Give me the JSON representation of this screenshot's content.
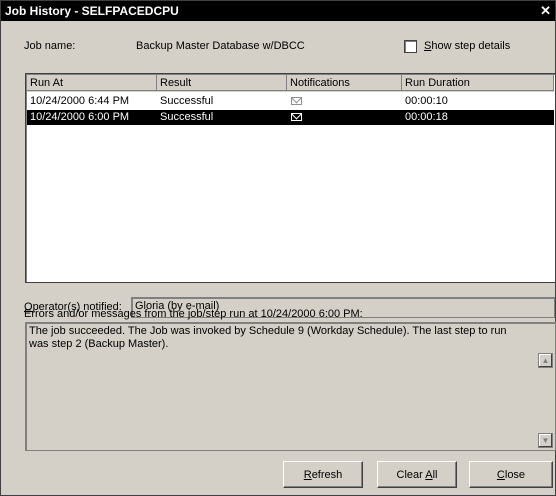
{
  "window": {
    "title": "Job History - SELFPACEDCPU",
    "close_glyph": "✕"
  },
  "job": {
    "label": "Job name:",
    "value": "Backup Master Database w/DBCC"
  },
  "show_step_details": {
    "label": "Show step details",
    "checked": false
  },
  "table": {
    "columns": [
      "Run At",
      "Result",
      "Notifications",
      "Run Duration"
    ],
    "rows": [
      {
        "run_at": "10/24/2000  6:44 PM",
        "result": "Successful",
        "notification_icon": "envelope-icon",
        "duration": "00:00:10",
        "selected": false
      },
      {
        "run_at": "10/24/2000  6:00 PM",
        "result": "Successful",
        "notification_icon": "envelope-icon",
        "duration": "00:00:18",
        "selected": true
      }
    ]
  },
  "operators": {
    "label": "Operator(s) notified:",
    "value": "Gloria (by e-mail)"
  },
  "messages": {
    "label": "Errors and/or messages from the job/step run at 10/24/2000  6:00 PM:",
    "text": "The job succeeded.  The Job was invoked by Schedule 9 (Workday Schedule).  The last step to run was step 2 (Backup Master)."
  },
  "buttons": {
    "refresh": "Refresh",
    "clear_all": "Clear All",
    "close": "Close"
  }
}
